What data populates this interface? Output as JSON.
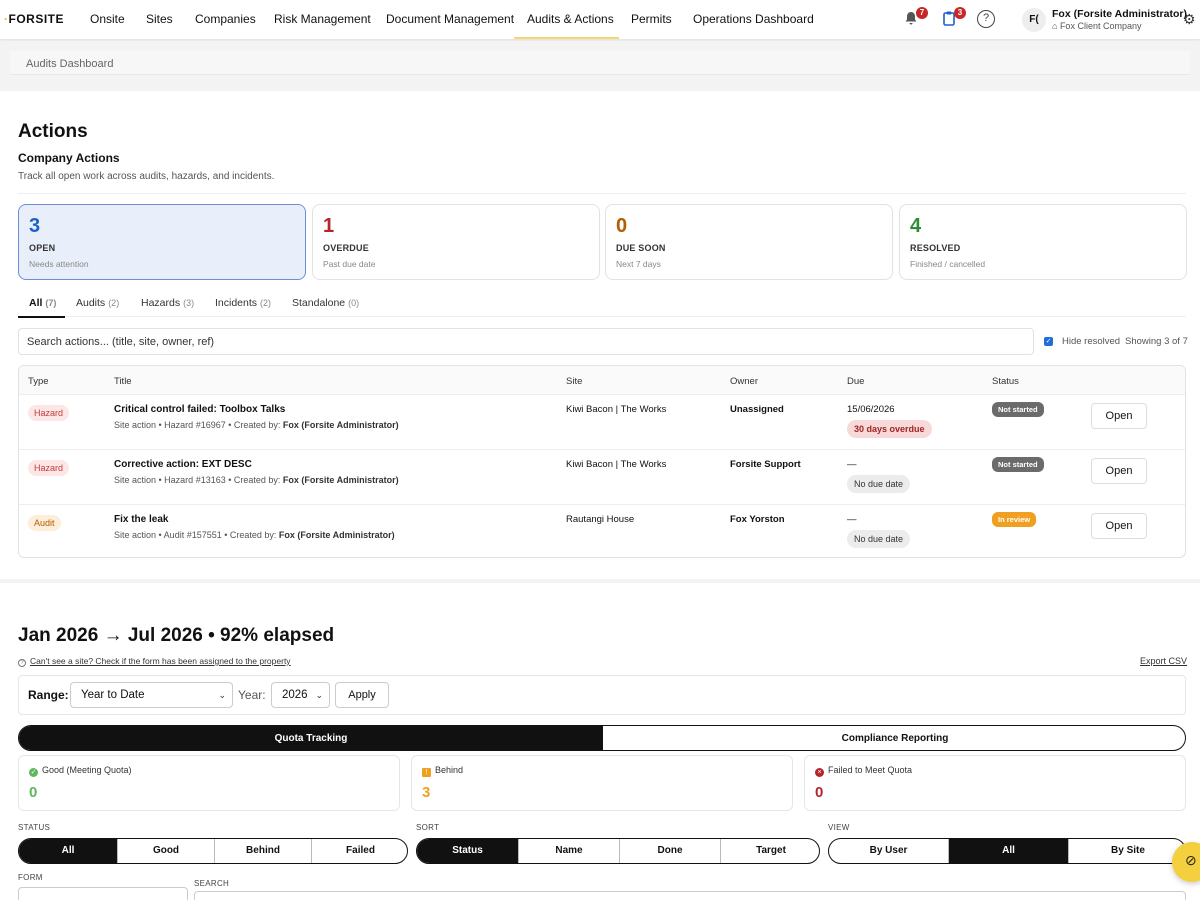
{
  "nav": {
    "logo": "FORSITE",
    "items": [
      "Onsite",
      "Sites",
      "Companies",
      "Risk Management",
      "Document Management",
      "Audits & Actions",
      "Permits",
      "Operations Dashboard"
    ],
    "notifications_count": "7",
    "clipboard_count": "3",
    "help_glyph": "?",
    "avatar_initials": "F(",
    "user_name": "Fox (Forsite Administrator)",
    "user_company": "Fox Client Company"
  },
  "breadcrumb": "Audits Dashboard",
  "actions": {
    "title": "Actions",
    "subtitle": "Company Actions",
    "description": "Track all open work across audits, hazards, and incidents.",
    "stats": [
      {
        "value": "3",
        "label": "OPEN",
        "hint": "Needs attention",
        "color": "#1e5fc9"
      },
      {
        "value": "1",
        "label": "OVERDUE",
        "hint": "Past due date",
        "color": "#b3262c"
      },
      {
        "value": "0",
        "label": "DUE SOON",
        "hint": "Next 7 days",
        "color": "#b35c00"
      },
      {
        "value": "4",
        "label": "RESOLVED",
        "hint": "Finished / cancelled",
        "color": "#2e8b3a"
      }
    ],
    "tabs": [
      {
        "label": "All",
        "count": "(7)"
      },
      {
        "label": "Audits",
        "count": "(2)"
      },
      {
        "label": "Hazards",
        "count": "(3)"
      },
      {
        "label": "Incidents",
        "count": "(2)"
      },
      {
        "label": "Standalone",
        "count": "(0)"
      }
    ],
    "search_placeholder": "Search actions... (title, site, owner, ref)",
    "hide_resolved_label": "Hide resolved",
    "showing_text": "Showing 3 of 7",
    "columns": [
      "Type",
      "Title",
      "Site",
      "Owner",
      "Due",
      "Status"
    ],
    "rows": [
      {
        "type": "Hazard",
        "title": "Critical control failed: Toolbox Talks",
        "meta_prefix": "Site action  •  Hazard #16967  •  Created by: ",
        "meta_creator": "Fox (Forsite Administrator)",
        "site": "Kiwi Bacon | The Works",
        "owner": "Unassigned",
        "due": "15/06/2026",
        "due_pill": "30 days overdue",
        "status": "Not started",
        "button": "Open"
      },
      {
        "type": "Hazard",
        "title": "Corrective action: EXT DESC",
        "meta_prefix": "Site action  •  Hazard #13163  •  Created by: ",
        "meta_creator": "Fox (Forsite Administrator)",
        "site": "Kiwi Bacon | The Works",
        "owner": "Forsite Support",
        "due": "—",
        "due_pill": "No due date",
        "status": "Not started",
        "button": "Open"
      },
      {
        "type": "Audit",
        "title": "Fix the leak",
        "meta_prefix": "Site action  •  Audit #157551  •  Created by: ",
        "meta_creator": "Fox (Forsite Administrator)",
        "site": "Rautangi House",
        "owner": "Fox Yorston",
        "due": "—",
        "due_pill": "No due date",
        "status": "In review",
        "button": "Open"
      }
    ]
  },
  "quota": {
    "title": "Jan 2026 → Jul 2026 • 92% elapsed",
    "note": "Can't see a site? Check if the form has been assigned to the property",
    "export": "Export CSV",
    "range_label": "Range:",
    "range_value": "Year to Date",
    "year_label": "Year:",
    "year_value": "2026",
    "apply": "Apply",
    "segments": [
      "Quota Tracking",
      "Compliance Reporting"
    ],
    "cards": [
      {
        "label": "Good (Meeting Quota)",
        "value": "0",
        "color": "#5cb85c",
        "icon": "✓"
      },
      {
        "label": "Behind",
        "value": "3",
        "color": "#f0a020",
        "icon": "!"
      },
      {
        "label": "Failed to Meet Quota",
        "value": "0",
        "color": "#b3262c",
        "icon": "×"
      }
    ],
    "status_label": "STATUS",
    "status_options": [
      "All",
      "Good",
      "Behind",
      "Failed"
    ],
    "sort_label": "SORT",
    "sort_options": [
      "Status",
      "Name",
      "Done",
      "Target"
    ],
    "view_label": "VIEW",
    "view_options": [
      "By User",
      "All",
      "By Site"
    ],
    "form_label": "FORM",
    "search_label": "SEARCH",
    "fab_glyph": "⊘"
  }
}
